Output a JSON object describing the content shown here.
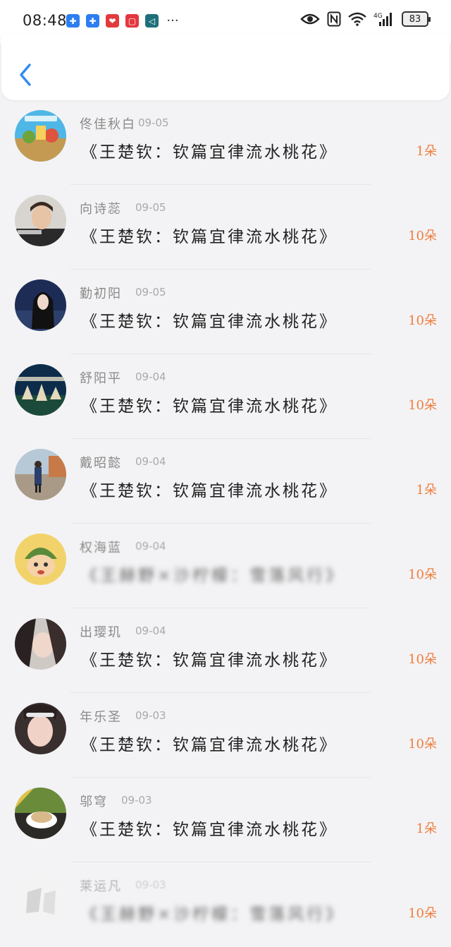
{
  "status_bar": {
    "time": "08:48",
    "notification_icons": [
      "puzzle-icon",
      "puzzle-icon",
      "gift-icon",
      "mail-icon",
      "send-icon"
    ],
    "more": "···",
    "battery": "83",
    "network": "4G"
  },
  "colors": {
    "accent_back": "#2f8cf0",
    "count_color": "#f07d3c"
  },
  "items": [
    {
      "name": "佟佳秋白",
      "date": "09-05",
      "title": "《王楚钦：钦篇宜律流水桃花》",
      "count": "1朵"
    },
    {
      "name": "向诗蕊",
      "date": "09-05",
      "title": "《王楚钦：钦篇宜律流水桃花》",
      "count": "10朵"
    },
    {
      "name": "勤初阳",
      "date": "09-05",
      "title": "《王楚钦：钦篇宜律流水桃花》",
      "count": "10朵"
    },
    {
      "name": "舒阳平",
      "date": "09-04",
      "title": "《王楚钦：钦篇宜律流水桃花》",
      "count": "10朵"
    },
    {
      "name": "戴昭懿",
      "date": "09-04",
      "title": "《王楚钦：钦篇宜律流水桃花》",
      "count": "1朵"
    },
    {
      "name": "权海蓝",
      "date": "09-04",
      "title": "《王赫野×沙柠檬：雪落风行》",
      "count": "10朵"
    },
    {
      "name": "出璎玑",
      "date": "09-04",
      "title": "《王楚钦：钦篇宜律流水桃花》",
      "count": "10朵"
    },
    {
      "name": "年乐圣",
      "date": "09-03",
      "title": "《王楚钦：钦篇宜律流水桃花》",
      "count": "10朵"
    },
    {
      "name": "邬穹",
      "date": "09-03",
      "title": "《王楚钦：钦篇宜律流水桃花》",
      "count": "1朵"
    },
    {
      "name": "莱运凡",
      "date": "09-03",
      "title": "《王赫野×沙柠檬：雪落风行》",
      "count": "10朵"
    }
  ]
}
